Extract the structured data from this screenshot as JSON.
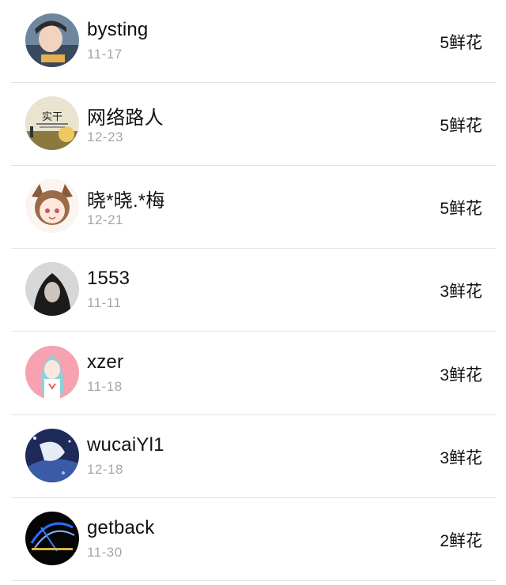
{
  "flower_unit": "鲜花",
  "items": [
    {
      "name": "bysting",
      "date": "11-17",
      "flowers": "5鲜花",
      "avatar": "photo-avatar"
    },
    {
      "name": "网络路人",
      "date": "12-23",
      "flowers": "5鲜花",
      "avatar": "landscape-avatar",
      "avatar_text": "实干"
    },
    {
      "name": "晓*晓.*梅",
      "date": "12-21",
      "flowers": "5鲜花",
      "avatar": "anime-girl-avatar"
    },
    {
      "name": "1553",
      "date": "11-11",
      "flowers": "3鲜花",
      "avatar": "hooded-person-avatar"
    },
    {
      "name": "xzer",
      "date": "11-18",
      "flowers": "3鲜花",
      "avatar": "anime-pink-avatar"
    },
    {
      "name": "wucaiYl1",
      "date": "12-18",
      "flowers": "3鲜花",
      "avatar": "anime-blue-avatar"
    },
    {
      "name": "getback",
      "date": "11-30",
      "flowers": "2鲜花",
      "avatar": "dark-light-avatar"
    }
  ]
}
